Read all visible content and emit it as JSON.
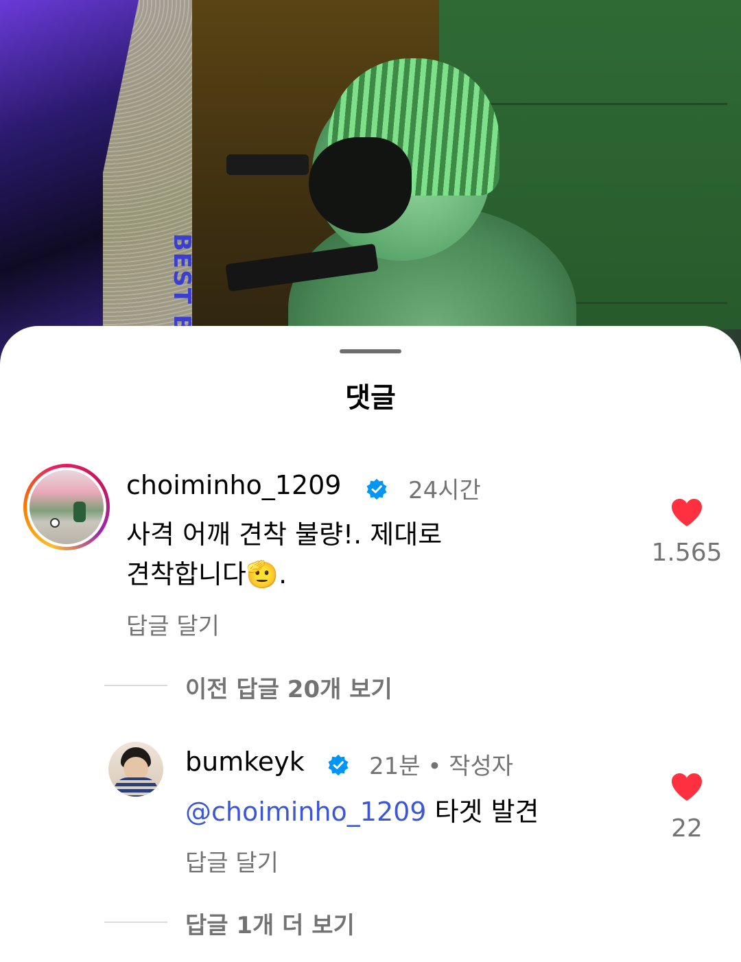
{
  "sheet": {
    "title": "댓글"
  },
  "comments": [
    {
      "username": "choiminho_1209",
      "verified": true,
      "time": "24시간",
      "text_line1": "사격 어깨 견착 불량!. 제대로",
      "text_line2": "견착합니다",
      "text_line2_end": ".",
      "emoji": "🫡",
      "reply_label": "답글 달기",
      "likes": "1.565",
      "icon": "heart-icon"
    }
  ],
  "view_previous": "이전 답글 20개 보기",
  "replies": [
    {
      "username": "bumkeyk",
      "verified": true,
      "time": "21분 • 작성자",
      "mention": "@choiminho_1209",
      "text": " 타겟 발견",
      "reply_label": "답글 달기",
      "likes": "22",
      "icon": "heart-icon"
    }
  ],
  "view_more": "답글 1개 더 보기",
  "colors": {
    "heart": "#ff3040",
    "verified": "#0095f6",
    "mention": "#3b57d8",
    "muted": "#737373"
  }
}
